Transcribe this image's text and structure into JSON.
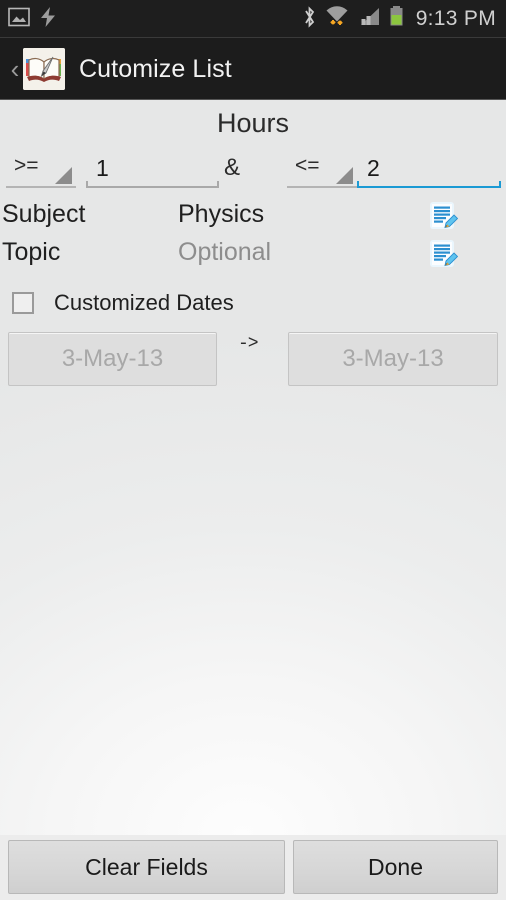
{
  "status_bar": {
    "time": "9:13 PM",
    "left_icons": [
      "image-icon",
      "charging-bolt-icon"
    ],
    "right_icons": [
      "bluetooth-icon",
      "wifi-icon",
      "cellular-signal-icon",
      "battery-icon"
    ],
    "battery_color": "#8cc63f",
    "wifi_arrow_color": "#f5a623"
  },
  "action_bar": {
    "back_glyph": "‹",
    "app_icon": "book-quill-icon",
    "title": "Cutomize List"
  },
  "form": {
    "section_title": "Hours",
    "min_operator": ">=",
    "min_value": "1",
    "conjunction": "&",
    "max_operator": "<=",
    "max_value": "2",
    "max_focused": true,
    "focus_color": "#1b9ad4",
    "subject_label": "Subject",
    "subject_value": "Physics",
    "topic_label": "Topic",
    "topic_placeholder": "Optional",
    "edit_icon": "note-edit-icon",
    "customized_dates_label": "Customized Dates",
    "customized_dates_checked": false,
    "date_from": "3-May-13",
    "date_arrow": "->",
    "date_to": "3-May-13",
    "dates_enabled": false
  },
  "bottom_bar": {
    "clear_label": "Clear Fields",
    "done_label": "Done"
  }
}
